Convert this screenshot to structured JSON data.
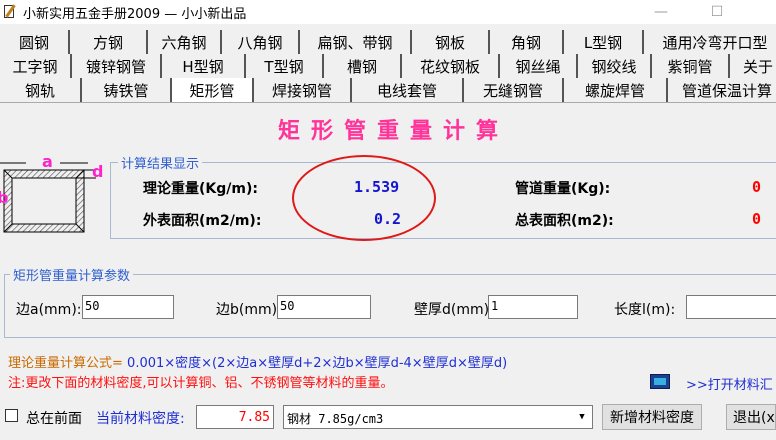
{
  "window": {
    "title": "小新实用五金手册2009 — 小小新出品",
    "minimize_glyph": "—",
    "maximize_glyph": "☐"
  },
  "tabs": {
    "row1": [
      "圆钢",
      "方钢",
      "六角钢",
      "八角钢",
      "扁钢、带钢",
      "钢板",
      "角钢",
      "L型钢",
      "通用冷弯开口型"
    ],
    "row2": [
      "工字钢",
      "镀锌钢管",
      "H型钢",
      "T型钢",
      "槽钢",
      "花纹钢板",
      "钢丝绳",
      "钢绞线",
      "紫铜管",
      "关于"
    ],
    "row3": [
      "钢轨",
      "铸铁管",
      "矩形管",
      "焊接钢管",
      "电线套管",
      "无缝钢管",
      "螺旋焊管",
      "管道保温计算"
    ],
    "active": "矩形管"
  },
  "page": {
    "title": "矩形管重量计算"
  },
  "diagram": {
    "label_a": "a",
    "label_b": "b",
    "label_d": "d"
  },
  "results": {
    "legend": "计算结果显示",
    "theoretical_weight_label": "理论重量(Kg/m):",
    "theoretical_weight_value": "1.539",
    "surface_area_label": "外表面积(m2/m):",
    "surface_area_value": "0.2",
    "pipe_weight_label": "管道重量(Kg):",
    "pipe_weight_value": "0",
    "total_surface_label": "总表面积(m2):",
    "total_surface_value": "0"
  },
  "params": {
    "legend": "矩形管重量计算参数",
    "side_a_label": "边a(mm):",
    "side_a_value": "50",
    "side_b_label": "边b(mm):",
    "side_b_value": "50",
    "thickness_label": "壁厚d(mm)",
    "thickness_value": "1",
    "length_label": "长度l(m):",
    "length_value": ""
  },
  "formula": {
    "label": "理论重量计算公式=",
    "expression": "0.001×密度×(2×边a×壁厚d+2×边b×壁厚d-4×壁厚d×壁厚d)",
    "note": "注:更改下面的材料密度,可以计算铜、铝、不锈钢管等材料的重量。",
    "library_link": ">>打开材料汇"
  },
  "bottom": {
    "always_on_top_label": "总在前面",
    "density_label": "当前材料密度:",
    "density_value": "7.85",
    "material_selected": "钢材 7.85g/cm3",
    "add_density_button": "新增材料密度",
    "exit_button": "退出(x)"
  },
  "colors": {
    "title_pink": "#ff3399",
    "value_blue": "#1515d0",
    "value_red": "#ff0000",
    "legend_blue": "#2f5fd0",
    "formula_orange": "#c96a00",
    "ellipse_red": "#e01818"
  }
}
